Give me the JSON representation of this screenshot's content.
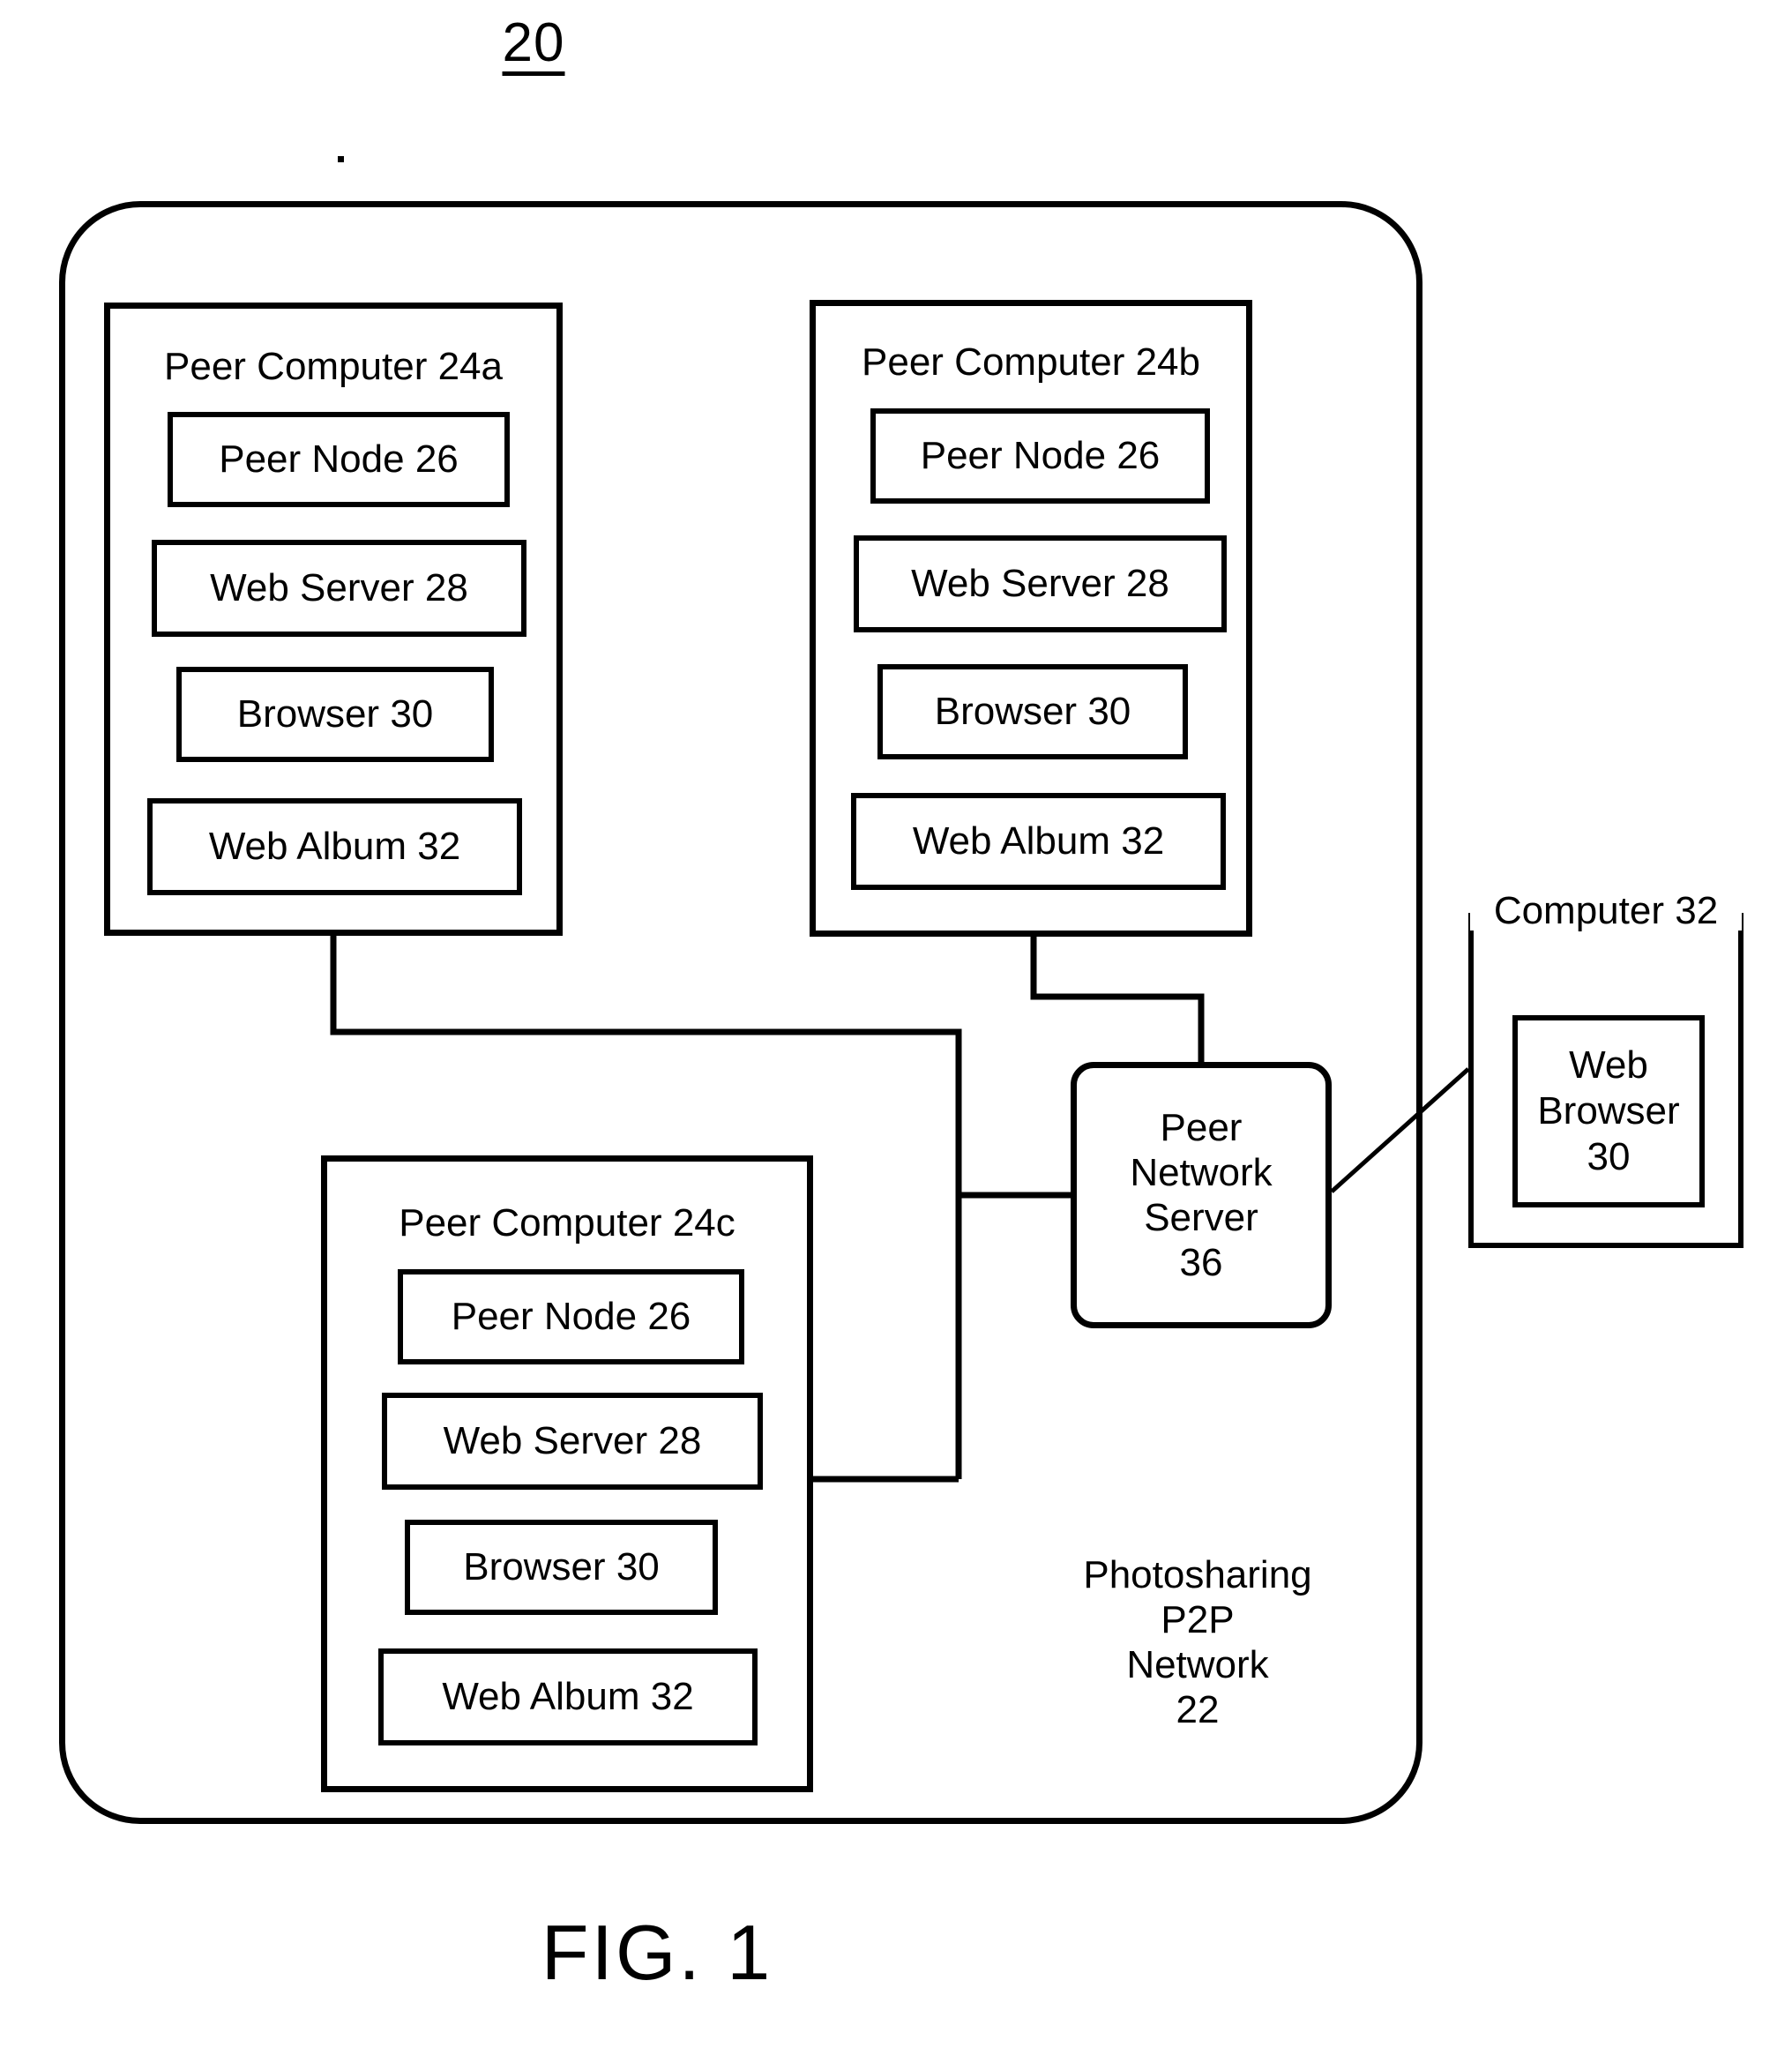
{
  "figure": {
    "reference_numeral": "20",
    "caption": "FIG. 1"
  },
  "network_boundary": {
    "name": "Photosharing P2P Network",
    "caption_lines": [
      "Photosharing",
      "P2P",
      "Network",
      "22"
    ],
    "reference_numeral": "22"
  },
  "peer_computers": [
    {
      "title": "Peer Computer 24a",
      "reference_numeral": "24a",
      "modules": [
        {
          "label": "Peer Node 26",
          "reference_numeral": "26"
        },
        {
          "label": "Web Server 28",
          "reference_numeral": "28"
        },
        {
          "label": "Browser 30",
          "reference_numeral": "30"
        },
        {
          "label": "Web Album 32",
          "reference_numeral": "32"
        }
      ]
    },
    {
      "title": "Peer Computer 24b",
      "reference_numeral": "24b",
      "modules": [
        {
          "label": "Peer Node 26",
          "reference_numeral": "26"
        },
        {
          "label": "Web Server 28",
          "reference_numeral": "28"
        },
        {
          "label": "Browser 30",
          "reference_numeral": "30"
        },
        {
          "label": "Web Album 32",
          "reference_numeral": "32"
        }
      ]
    },
    {
      "title": "Peer Computer 24c",
      "reference_numeral": "24c",
      "modules": [
        {
          "label": "Peer Node 26",
          "reference_numeral": "26"
        },
        {
          "label": "Web Server 28",
          "reference_numeral": "28"
        },
        {
          "label": "Browser 30",
          "reference_numeral": "30"
        },
        {
          "label": "Web Album 32",
          "reference_numeral": "32"
        }
      ]
    }
  ],
  "peer_network_server": {
    "lines": [
      "Peer",
      "Network",
      "Server",
      "36"
    ],
    "reference_numeral": "36"
  },
  "external_computer": {
    "title": "Computer 32",
    "reference_numeral": "32",
    "browser": {
      "lines": [
        "Web",
        "Browser",
        "30"
      ],
      "reference_numeral": "30"
    }
  },
  "style": {
    "line_color": "#000000",
    "background_color": "#ffffff"
  }
}
